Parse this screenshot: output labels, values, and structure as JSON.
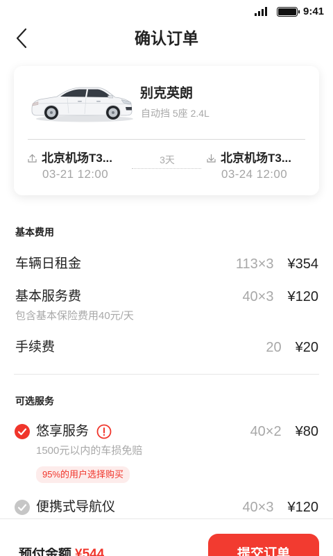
{
  "status_bar": {
    "time": "9:41",
    "signal_icon": "signal-icon",
    "battery_icon": "battery-icon"
  },
  "header": {
    "title": "确认订单",
    "back_icon": "chevron-left-icon"
  },
  "car": {
    "name": "别克英朗",
    "specs": "自动挡 5座 2.4L",
    "image_icon": "car-image",
    "pickup": {
      "icon": "upload-icon",
      "location": "北京机场T3...",
      "time": "03-21 12:00"
    },
    "duration": "3天",
    "return": {
      "icon": "download-icon",
      "location": "北京机场T3...",
      "time": "03-24 12:00"
    }
  },
  "basic_fees": {
    "title": "基本费用",
    "items": [
      {
        "label": "车辆日租金",
        "calc": "113×3",
        "amount": "¥354"
      },
      {
        "label": "基本服务费",
        "note": "包含基本保险费用40元/天",
        "calc": "40×3",
        "amount": "¥120"
      },
      {
        "label": "手续费",
        "calc": "20",
        "amount": "¥20"
      }
    ]
  },
  "optional_services": {
    "title": "可选服务",
    "items": [
      {
        "label": "悠享服务",
        "selected": true,
        "info_icon": "info-icon",
        "calc": "40×2",
        "amount": "¥80",
        "note": "1500元以内的车损免赔",
        "badge": "95%的用户选择购买"
      },
      {
        "label": "便携式导航仪",
        "selected": false,
        "calc": "40×3",
        "amount": "¥120"
      }
    ]
  },
  "footer": {
    "prepay_label": "预付金额",
    "prepay_amount": "¥544",
    "submit_label": "提交订单"
  },
  "colors": {
    "accent": "#f0352b",
    "button": "#f23b30",
    "text": "#222222",
    "muted": "#a8a8a8",
    "badge_bg": "#fdeceb",
    "unchecked": "#c6c6c6"
  }
}
